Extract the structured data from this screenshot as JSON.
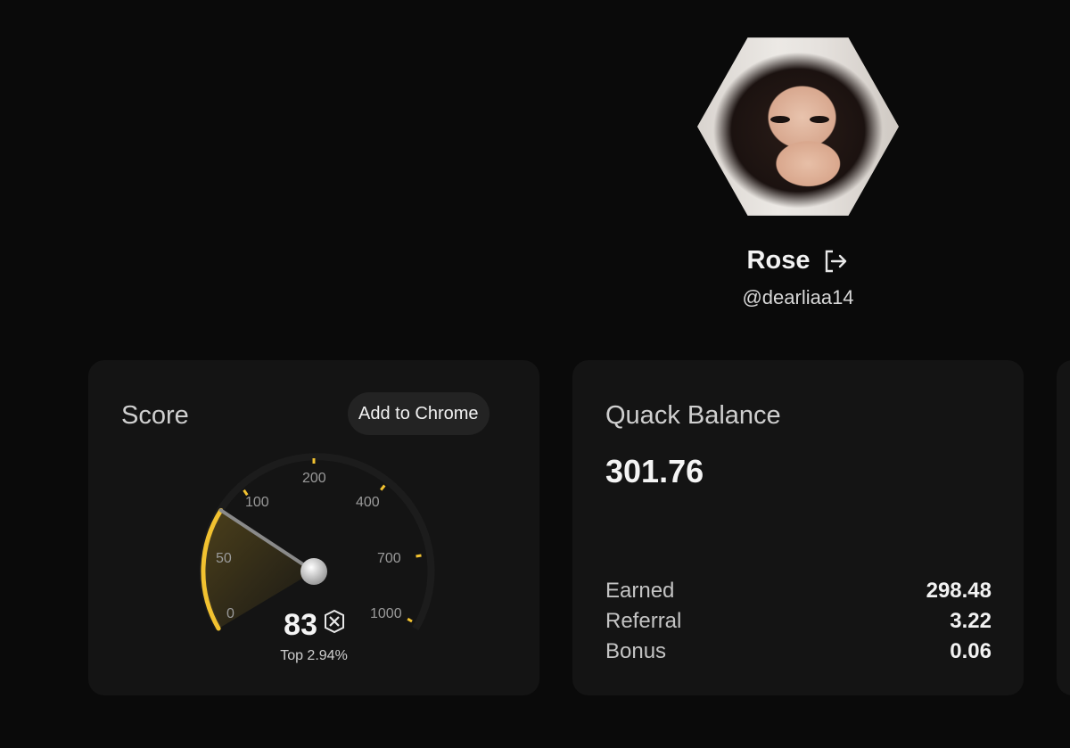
{
  "profile": {
    "name": "Rose",
    "handle": "@dearliaa14"
  },
  "score": {
    "title": "Score",
    "add_to_chrome": "Add to Chrome",
    "value": "83",
    "rank_text": "Top 2.94%",
    "scale_labels": [
      "0",
      "50",
      "100",
      "200",
      "400",
      "700",
      "1000"
    ],
    "accent_color": "#f2c230"
  },
  "balance": {
    "title": "Quack Balance",
    "value": "301.76",
    "rows": [
      {
        "label": "Earned",
        "value": "298.48"
      },
      {
        "label": "Referral",
        "value": "3.22"
      },
      {
        "label": "Bonus",
        "value": "0.06"
      }
    ]
  },
  "icons": {
    "logout": "logout-icon",
    "badge": "xs-badge-icon"
  }
}
